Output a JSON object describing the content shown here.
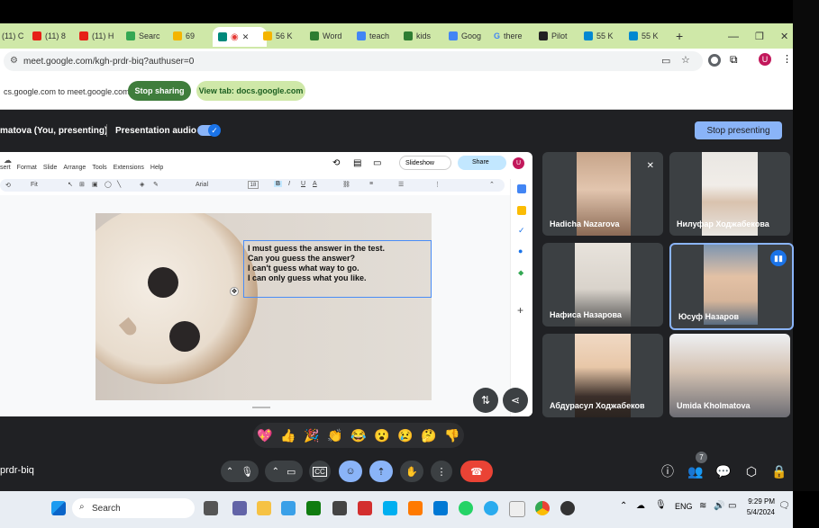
{
  "tabs": [
    "(11) C",
    "(11) 8",
    "(11) H",
    "Searc",
    "69",
    "",
    "56 K",
    "Word",
    "teach",
    "kids",
    "Goog",
    "there",
    "Pilot",
    "55 K",
    "55 K"
  ],
  "address": {
    "url": "meet.google.com/kgh-prdr-biq?authuser=0"
  },
  "share": {
    "status": "cs.google.com to meet.google.com",
    "stop_label": "Stop sharing",
    "view_tab_label": "View tab: docs.google.com"
  },
  "presenting": {
    "label": "matova (You, presenting)",
    "audio_label": "Presentation audio",
    "stop_label": "Stop presenting"
  },
  "editor": {
    "menus": [
      "sert",
      "Format",
      "Slide",
      "Arrange",
      "Tools",
      "Extensions",
      "Help"
    ],
    "slideshow_label": "Slideshow",
    "share_label": "Share",
    "avatar": "U",
    "zoom": "Fit",
    "font": "Arial",
    "font_size": "18",
    "slide_lines": [
      "I must guess the answer in the test.",
      "Can you guess the answer?",
      "I can't guess what way to go.",
      "I can only guess what you like."
    ]
  },
  "participants": [
    {
      "name": "Hadicha Nazarova",
      "muted": true
    },
    {
      "name": "Нилуфар Ходжабекова"
    },
    {
      "name": "Нафиса Назарова"
    },
    {
      "name": "Юсуф Назаров",
      "speaking": true
    },
    {
      "name": "Абдурасул Ходжабеков"
    },
    {
      "name": "Umida Kholmatova"
    }
  ],
  "reactions": [
    "💖",
    "👍",
    "🎉",
    "👏",
    "😂",
    "😮",
    "😢",
    "🤔",
    "👎"
  ],
  "meeting_code": "prdr-biq",
  "people_count": "7",
  "taskbar": {
    "search_placeholder": "Search",
    "lang": "ENG",
    "time": "9:29 PM",
    "date": "5/4/2024"
  },
  "colors": {
    "accent": "#8ab4f8",
    "stop_share": "#3f7d3c",
    "end_call": "#ea4335",
    "tab_strip": "#cfe8a8"
  }
}
